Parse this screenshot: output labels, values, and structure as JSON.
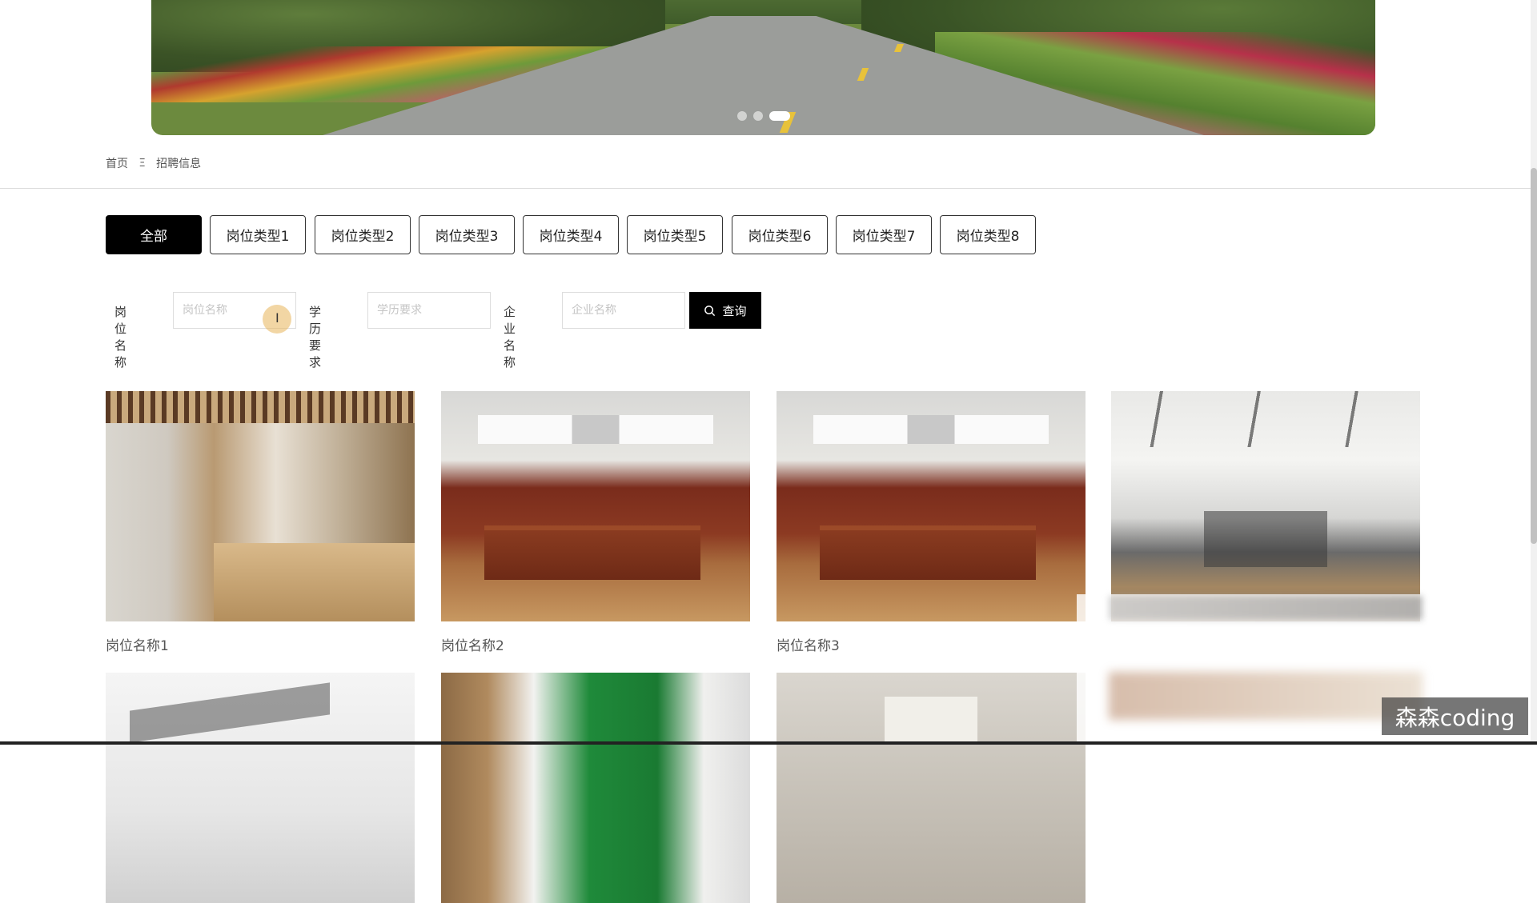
{
  "banner": {
    "slides_total": 3,
    "active_slide": 3
  },
  "breadcrumb": {
    "home": "首页",
    "separator": "Ξ",
    "current": "招聘信息"
  },
  "categories": [
    {
      "label": "全部",
      "active": true
    },
    {
      "label": "岗位类型1",
      "active": false
    },
    {
      "label": "岗位类型2",
      "active": false
    },
    {
      "label": "岗位类型3",
      "active": false
    },
    {
      "label": "岗位类型4",
      "active": false
    },
    {
      "label": "岗位类型5",
      "active": false
    },
    {
      "label": "岗位类型6",
      "active": false
    },
    {
      "label": "岗位类型7",
      "active": false
    },
    {
      "label": "岗位类型8",
      "active": false
    }
  ],
  "search": {
    "job_label": "岗位名称",
    "job_placeholder": "岗位名称",
    "job_value": "",
    "edu_label": "学历要求",
    "edu_placeholder": "学历要求",
    "edu_value": "",
    "company_label": "企业名称",
    "company_placeholder": "企业名称",
    "company_value": "",
    "button_label": "查询",
    "button_icon": "search-icon"
  },
  "jobs": [
    {
      "name": "岗位名称1",
      "image": "modern-office-workstations"
    },
    {
      "name": "岗位名称2",
      "image": "executive-office-desk"
    },
    {
      "name": "岗位名称3",
      "image": "executive-office-desk"
    },
    {
      "name": "",
      "image": "open-plan-office"
    }
  ],
  "jobs_row2": [
    {
      "image": "office-desks-topview"
    },
    {
      "image": "green-ceiling-office"
    },
    {
      "image": "meeting-room"
    }
  ],
  "watermark": "森森coding"
}
